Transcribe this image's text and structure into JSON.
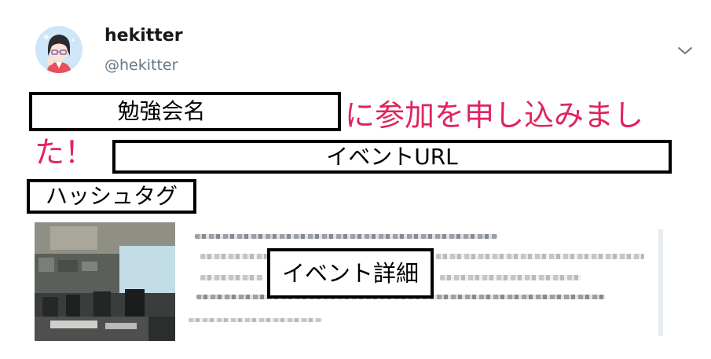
{
  "user": {
    "name": "hekitter",
    "handle": "@hekitter"
  },
  "tweet": {
    "event_name_placeholder": "勉強会名",
    "text_part1": "に参加を申し込みまし",
    "text_part2": "た！",
    "event_url_placeholder": "イベントURL",
    "hashtag_placeholder": "ハッシュタグ"
  },
  "card": {
    "event_detail_placeholder": "イベント詳細"
  },
  "icons": {
    "avatar": "avatar-image",
    "menu": "chevron-down-icon"
  },
  "colors": {
    "tweet_text": "#e0245e",
    "handle": "#657786",
    "name": "#14171a"
  }
}
